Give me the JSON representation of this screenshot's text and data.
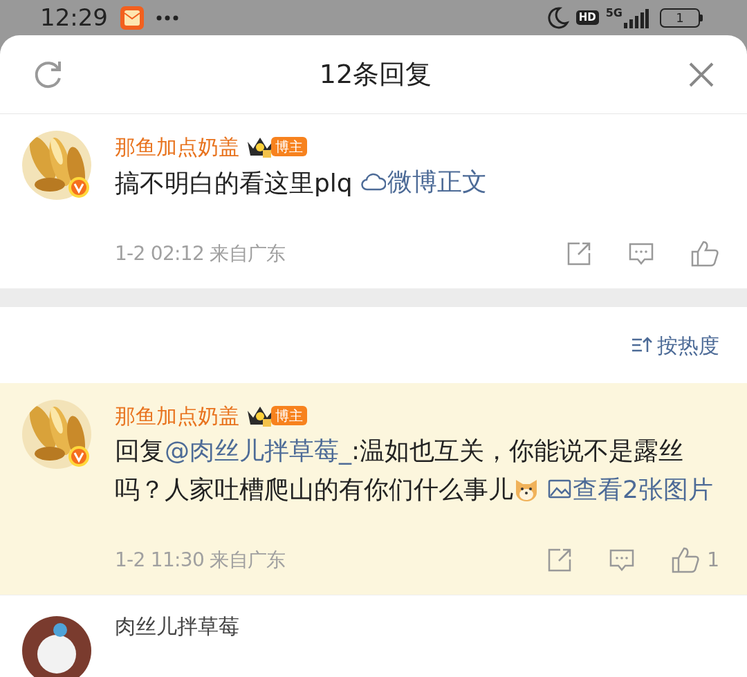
{
  "status_bar": {
    "time": "12:29",
    "hd": "HD",
    "network": "5G",
    "battery": "1"
  },
  "header": {
    "title": "12条回复"
  },
  "main_comment": {
    "name": "那鱼加点奶盖",
    "badge": "博主",
    "verified": true,
    "highlighted": false,
    "segments": [
      {
        "kind": "text",
        "text": "搞不明白的看这里plq"
      },
      {
        "kind": "weibo_link",
        "text": "微博正文"
      }
    ],
    "time": "1-2 02:12",
    "location": "来自广东"
  },
  "sort": {
    "label": "按热度"
  },
  "replies": [
    {
      "name": "那鱼加点奶盖",
      "badge": "博主",
      "verified": true,
      "highlighted": true,
      "segments": [
        {
          "kind": "text",
          "text": "回复"
        },
        {
          "kind": "mention",
          "text": "@肉丝儿拌草莓_"
        },
        {
          "kind": "text",
          "text": ":温如也互关，你能说不是露丝吗？人家吐槽爬山的有你们什么事儿"
        },
        {
          "kind": "emoji"
        },
        {
          "kind": "image_link",
          "text": "查看2张图片"
        }
      ],
      "time": "1-2 11:30",
      "location": "来自广东",
      "likes": "1"
    },
    {
      "name": "肉丝儿拌草莓",
      "verified": false,
      "highlighted": false
    }
  ]
}
